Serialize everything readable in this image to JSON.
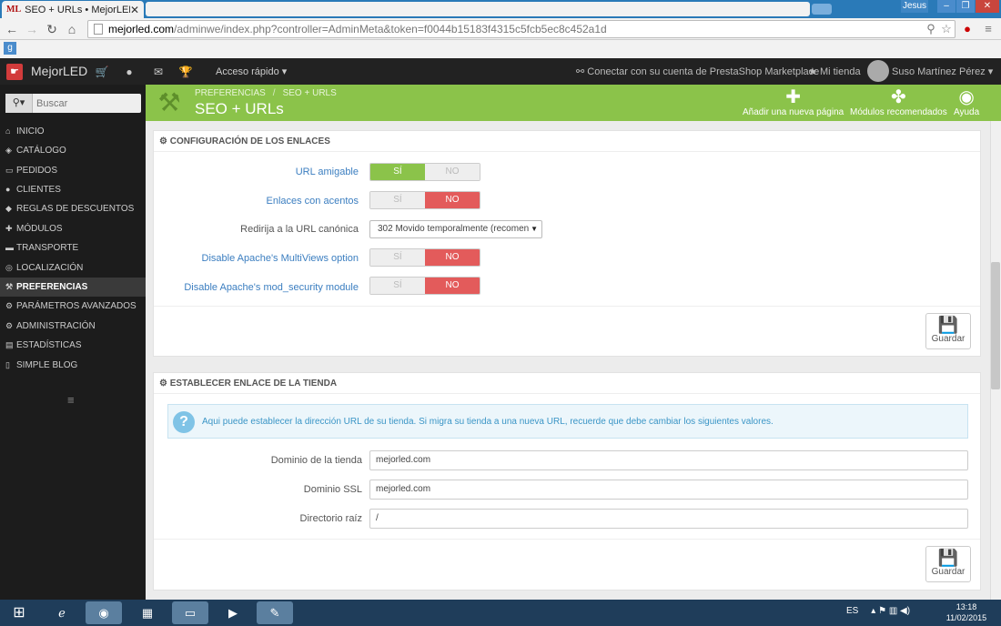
{
  "browser": {
    "tab_title": "SEO + URLs • MejorLED",
    "tab_favicon": "ML",
    "user_badge": "Jesus",
    "url_host": "mejorled.com",
    "url_path": "/adminwe/index.php?controller=AdminMeta&token=f0044b15183f4315c5fcb5ec8c452a1d"
  },
  "header": {
    "shop_name": "MejorLED",
    "quick_access": "Acceso rápido",
    "connect": "Conectar con su cuenta de PrestaShop Marketplace",
    "my_shop": "Mi tienda",
    "user": "Suso Martínez Pérez"
  },
  "toolbar": {
    "breadcrumb_1": "PREFERENCIAS",
    "breadcrumb_2": "SEO + URLS",
    "title": "SEO + URLs",
    "add_page": "Añadir una nueva página",
    "modules": "Módulos recomendados",
    "help": "Ayuda"
  },
  "sidebar": {
    "search_placeholder": "Buscar",
    "items": [
      {
        "label": "INICIO"
      },
      {
        "label": "CATÁLOGO"
      },
      {
        "label": "PEDIDOS"
      },
      {
        "label": "CLIENTES"
      },
      {
        "label": "REGLAS DE DESCUENTOS"
      },
      {
        "label": "MÓDULOS"
      },
      {
        "label": "TRANSPORTE"
      },
      {
        "label": "LOCALIZACIÓN"
      },
      {
        "label": "PREFERENCIAS"
      },
      {
        "label": "PARÁMETROS AVANZADOS"
      },
      {
        "label": "ADMINISTRACIÓN"
      },
      {
        "label": "ESTADÍSTICAS"
      },
      {
        "label": "SIMPLE BLOG"
      }
    ]
  },
  "links_panel": {
    "heading": "CONFIGURACIÓN DE LOS ENLACES",
    "yes": "SÍ",
    "no": "NO",
    "friendly_url": "URL amigable",
    "accents": "Enlaces con acentos",
    "canonical": "Redirija a la URL canónica",
    "canonical_value": "302 Movido temporalmente (recomen",
    "multiviews": "Disable Apache's MultiViews option",
    "mod_security": "Disable Apache's mod_security module",
    "save": "Guardar"
  },
  "shop_panel": {
    "heading": "ESTABLECER ENLACE DE LA TIENDA",
    "alert": "Aqui puede establecer la dirección URL de su tienda. Si migra su tienda a una nueva URL, recuerde que debe cambiar los siguientes valores.",
    "domain_label": "Dominio de la tienda",
    "domain_value": "mejorled.com",
    "ssl_label": "Dominio SSL",
    "ssl_value": "mejorled.com",
    "root_label": "Directorio raíz",
    "root_value": "/",
    "save": "Guardar"
  },
  "taskbar": {
    "lang": "ES",
    "time": "13:18",
    "date": "11/02/2015"
  }
}
